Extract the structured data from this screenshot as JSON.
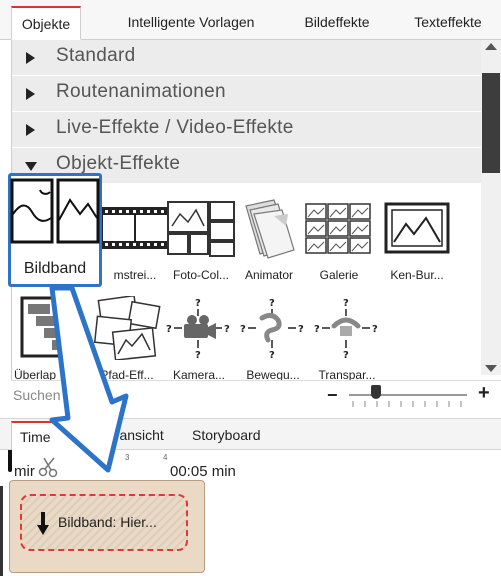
{
  "tabs": [
    "Objekte",
    "Intelligente Vorlagen",
    "Bildeffekte",
    "Texteffekte"
  ],
  "categories": [
    {
      "label": "Standard",
      "expanded": false
    },
    {
      "label": "Routenanimationen",
      "expanded": false
    },
    {
      "label": "Live-Effekte / Video-Effekte",
      "expanded": false
    },
    {
      "label": "Objekt-Effekte",
      "expanded": true
    }
  ],
  "effects_row1": [
    {
      "label": "Bildband",
      "icon": "photo-strip-icon",
      "selected": true
    },
    {
      "label": "mstrei...",
      "icon": "film-strip-icon"
    },
    {
      "label": "Foto-Col...",
      "icon": "photo-collage-icon"
    },
    {
      "label": "Animator",
      "icon": "page-stack-icon"
    },
    {
      "label": "Galerie",
      "icon": "gallery-icon"
    },
    {
      "label": "Ken-Bur...",
      "icon": "ken-burns-icon"
    }
  ],
  "effects_row2": [
    {
      "label": "Überlap",
      "icon": "overlap-icon"
    },
    {
      "label": "Pfad-Eff...",
      "icon": "path-effect-icon"
    },
    {
      "label": "Kamera...",
      "icon": "camera-question-icon"
    },
    {
      "label": "Bewegu...",
      "icon": "motion-question-icon"
    },
    {
      "label": "Transpar...",
      "icon": "transparency-question-icon"
    }
  ],
  "search": {
    "label": "Suchen"
  },
  "zoom": {
    "minus": "−",
    "plus": "+",
    "level": 0.2
  },
  "bottom_tabs": [
    "Time",
    "uransicht",
    "Storyboard"
  ],
  "ruler": {
    "time_start": "mir",
    "time_end": "00:05 min",
    "ticks": [
      "3",
      "4"
    ]
  },
  "clip": {
    "label": "Bildband: Hier..."
  },
  "colors": {
    "accent_tab": "#dd3333",
    "selection": "#2d73c7",
    "clip_bg": "#ead9c4",
    "dashed": "#d93a3a"
  }
}
